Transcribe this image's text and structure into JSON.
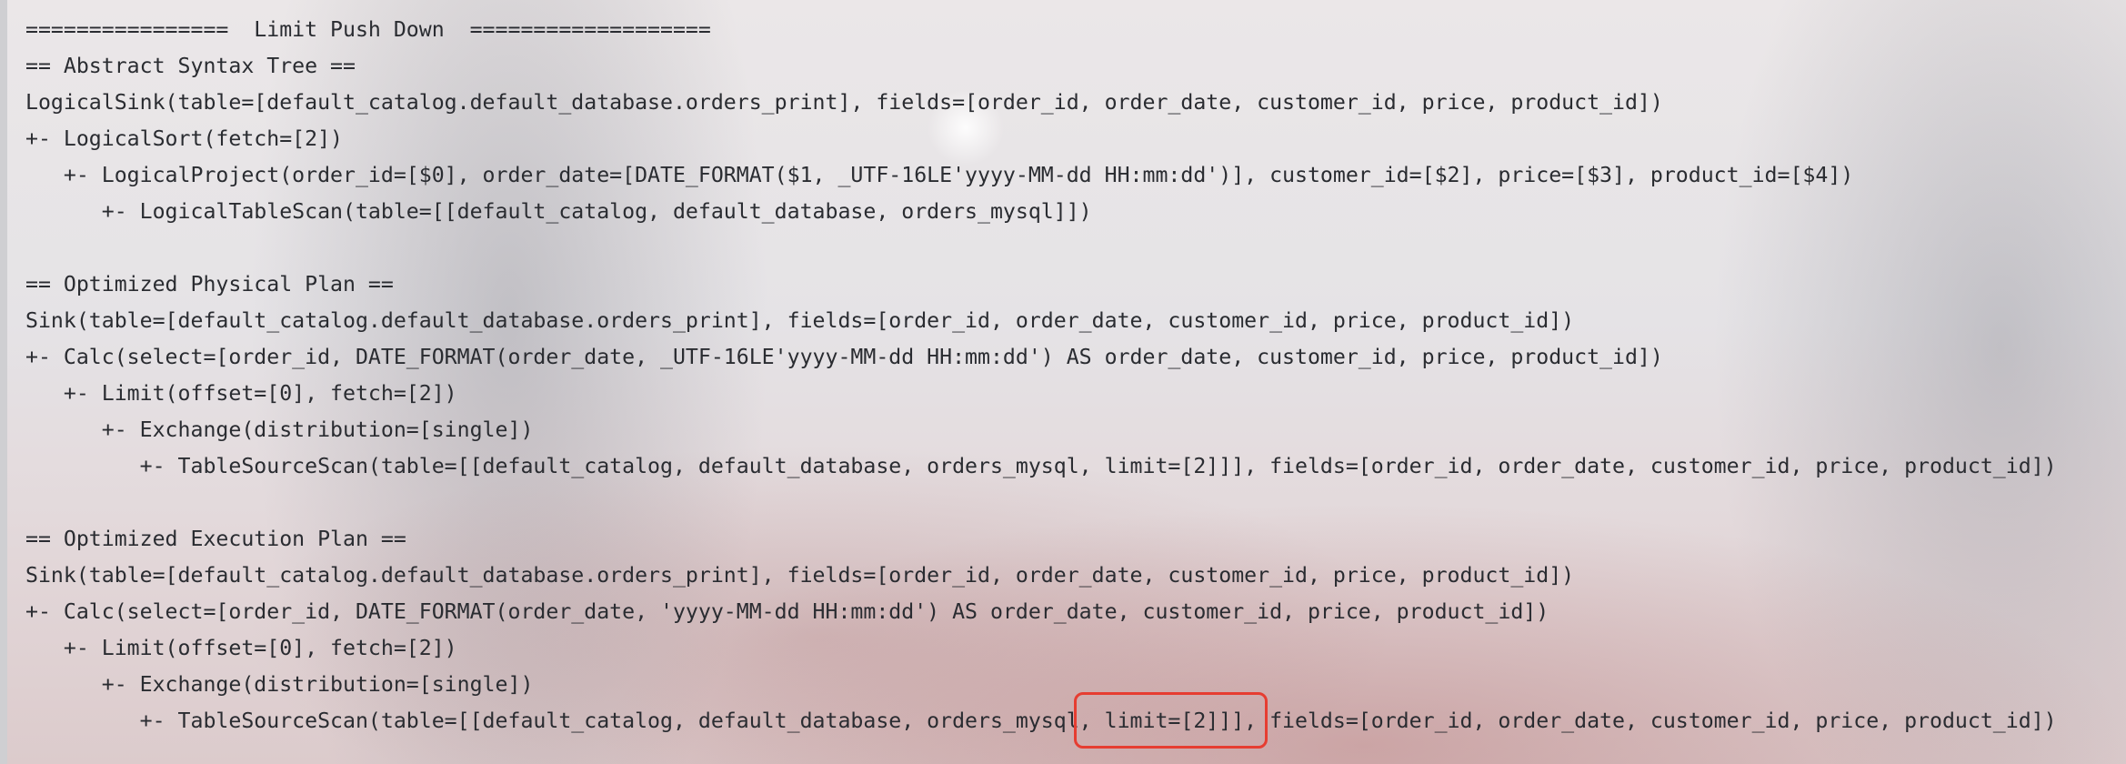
{
  "code_lines": [
    "================  Limit Push Down  ===================",
    "== Abstract Syntax Tree ==",
    "LogicalSink(table=[default_catalog.default_database.orders_print], fields=[order_id, order_date, customer_id, price, product_id])",
    "+- LogicalSort(fetch=[2])",
    "   +- LogicalProject(order_id=[$0], order_date=[DATE_FORMAT($1, _UTF-16LE'yyyy-MM-dd HH:mm:dd')], customer_id=[$2], price=[$3], product_id=[$4])",
    "      +- LogicalTableScan(table=[[default_catalog, default_database, orders_mysql]])",
    "",
    "== Optimized Physical Plan ==",
    "Sink(table=[default_catalog.default_database.orders_print], fields=[order_id, order_date, customer_id, price, product_id])",
    "+- Calc(select=[order_id, DATE_FORMAT(order_date, _UTF-16LE'yyyy-MM-dd HH:mm:dd') AS order_date, customer_id, price, product_id])",
    "   +- Limit(offset=[0], fetch=[2])",
    "      +- Exchange(distribution=[single])",
    "         +- TableSourceScan(table=[[default_catalog, default_database, orders_mysql, limit=[2]]], fields=[order_id, order_date, customer_id, price, product_id])",
    "",
    "== Optimized Execution Plan ==",
    "Sink(table=[default_catalog.default_database.orders_print], fields=[order_id, order_date, customer_id, price, product_id])",
    "+- Calc(select=[order_id, DATE_FORMAT(order_date, 'yyyy-MM-dd HH:mm:dd') AS order_date, customer_id, price, product_id])",
    "   +- Limit(offset=[0], fetch=[2])",
    "      +- Exchange(distribution=[single])",
    "         +- TableSourceScan(table=[[default_catalog, default_database, orders_mysql, limit=[2]]], fields=[order_id, order_date, customer_id, price, product_id])"
  ],
  "highlight": {
    "text": ", limit=[2]]],",
    "color": "#e63d31"
  },
  "colors": {
    "text": "#2a2c31"
  }
}
